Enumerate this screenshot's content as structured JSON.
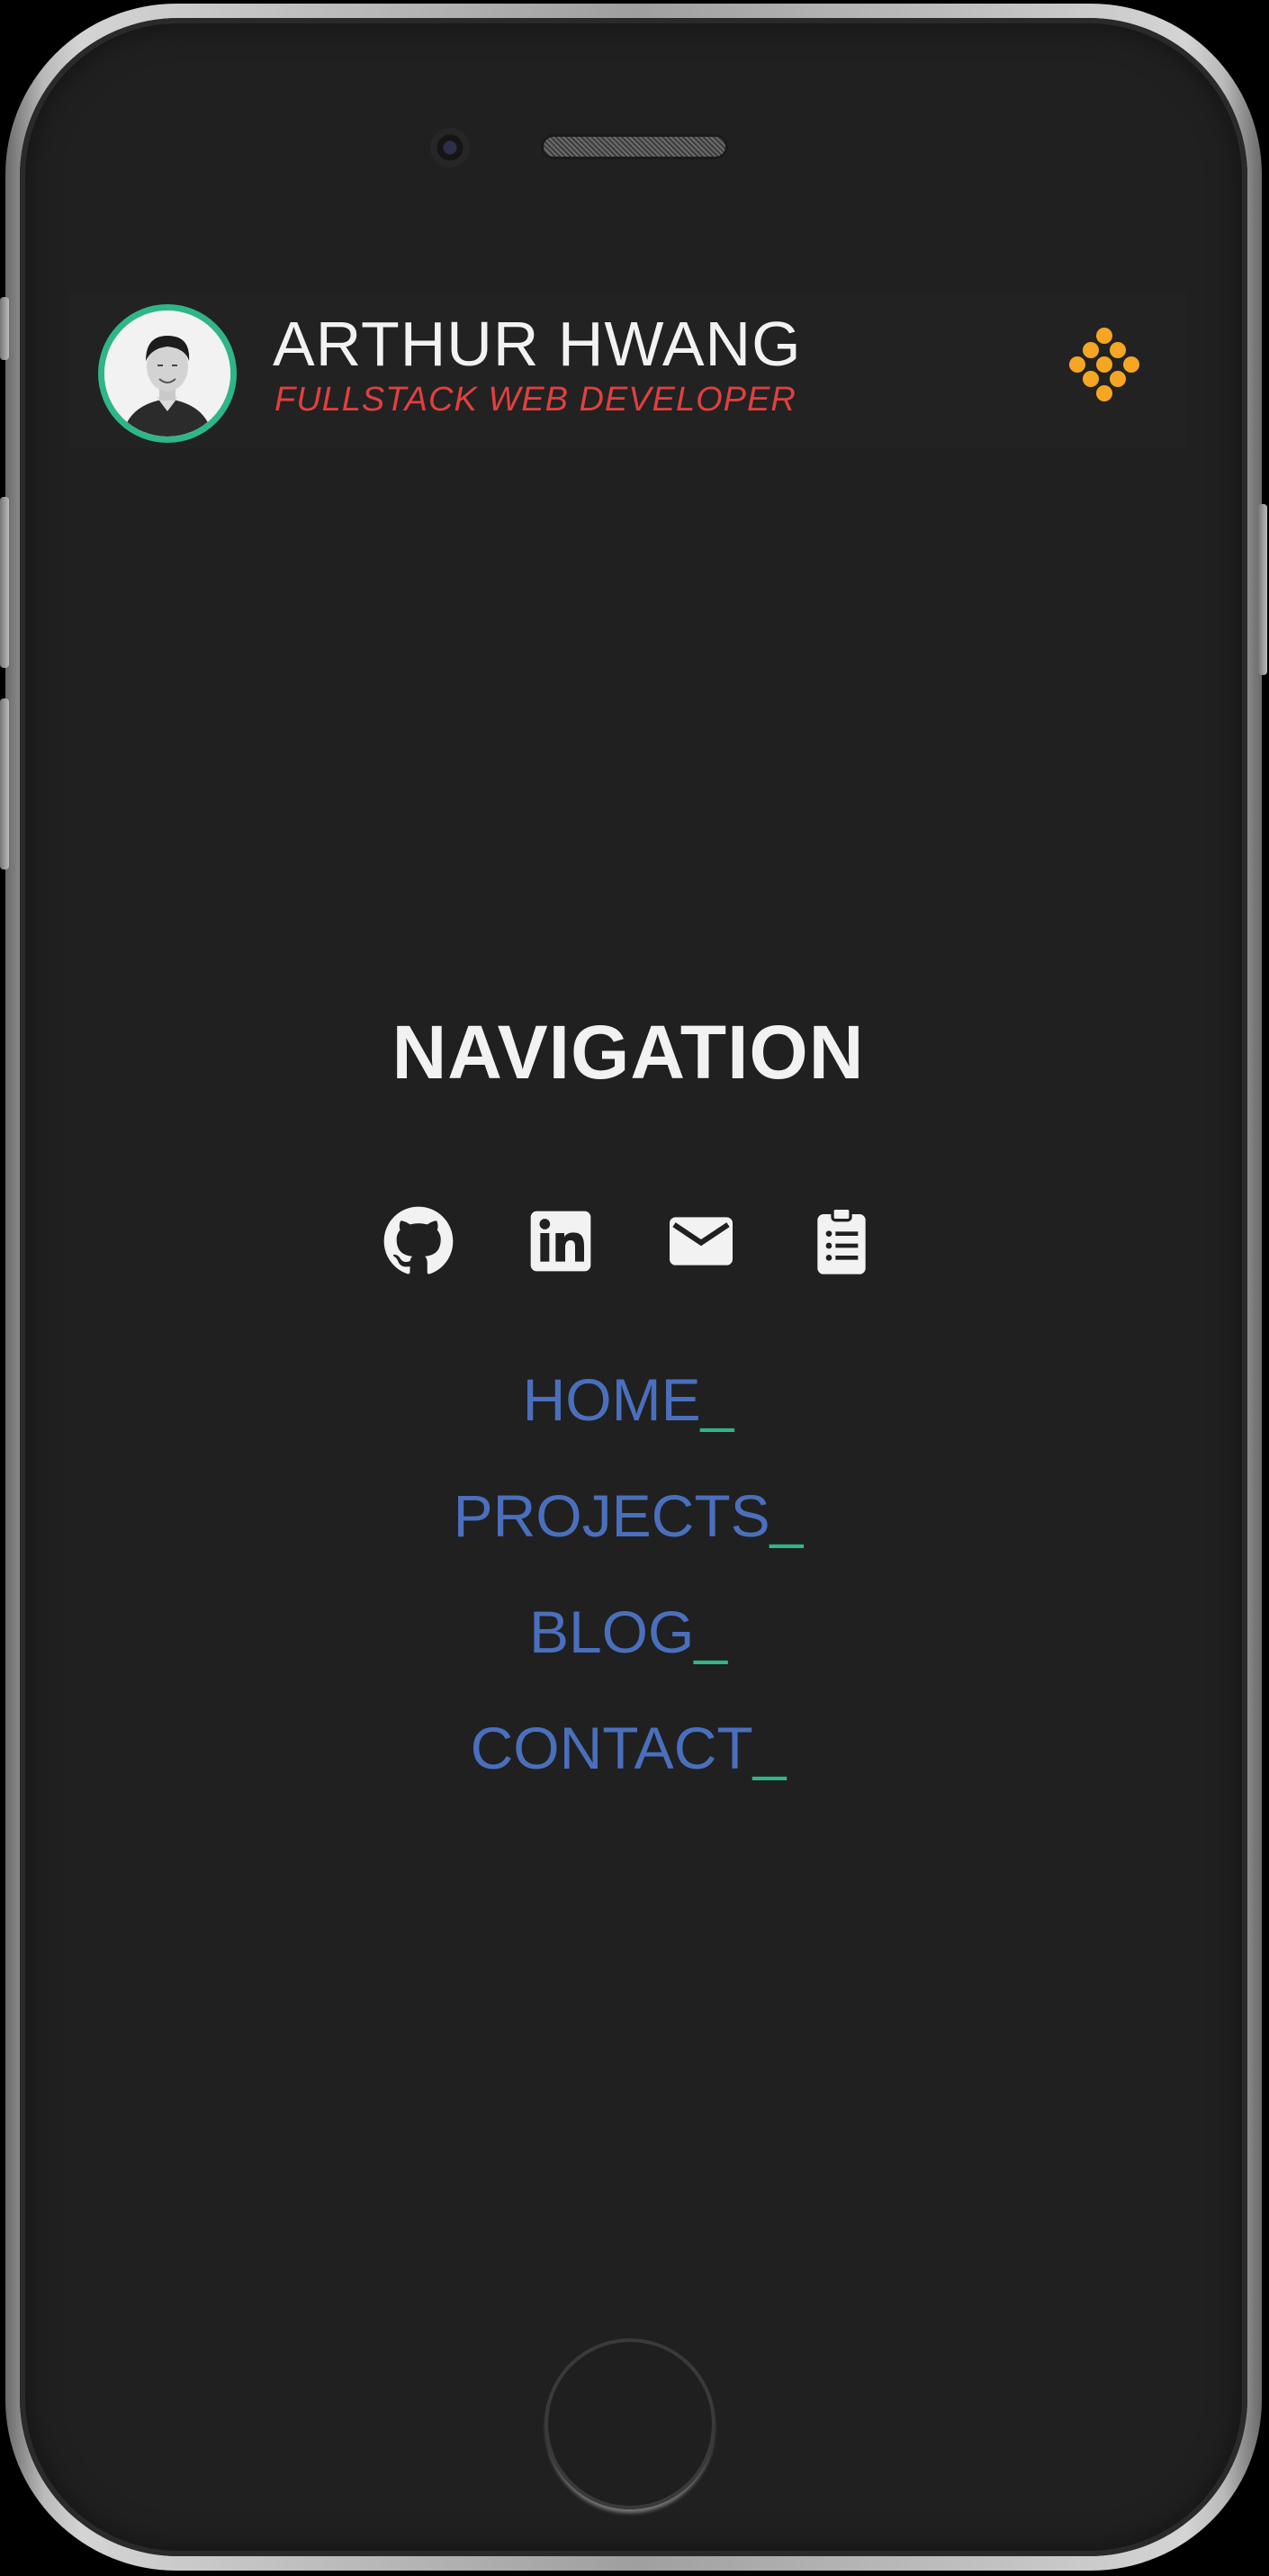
{
  "header": {
    "name": "ARTHUR HWANG",
    "role": "FULLSTACK WEB DEVELOPER",
    "avatar_icon": "profile-photo",
    "menu_icon": "dots-diamond-icon"
  },
  "navigation": {
    "title": "NAVIGATION",
    "social": [
      {
        "icon": "github-icon"
      },
      {
        "icon": "linkedin-icon"
      },
      {
        "icon": "email-icon"
      },
      {
        "icon": "resume-clipboard-icon"
      }
    ],
    "links": [
      {
        "label": "HOME",
        "cursor": "_"
      },
      {
        "label": "PROJECTS",
        "cursor": "_"
      },
      {
        "label": "BLOG",
        "cursor": "_"
      },
      {
        "label": "CONTACT",
        "cursor": "_"
      }
    ]
  },
  "colors": {
    "background": "#202020",
    "accent_green": "#2fb58a",
    "role_red": "#e0403f",
    "link_blue": "#4a6fbd",
    "menu_orange": "#f5a623"
  }
}
